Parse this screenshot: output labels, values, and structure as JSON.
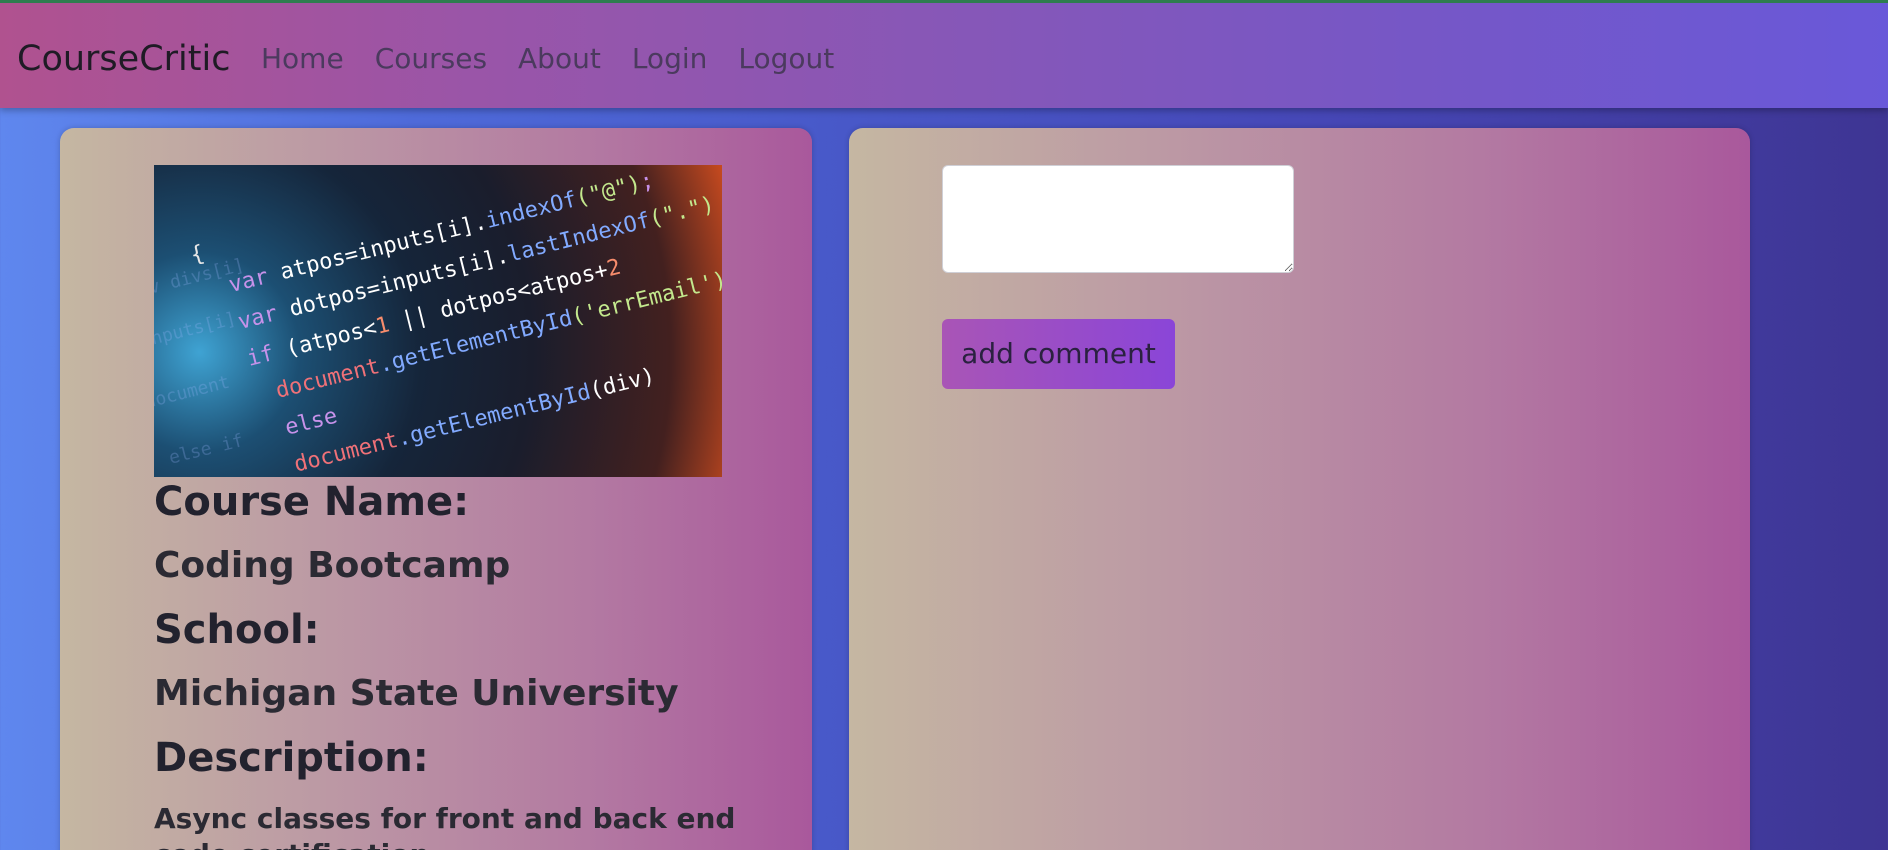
{
  "navbar": {
    "brand": "CourseCritic",
    "links": [
      "Home",
      "Courses",
      "About",
      "Login",
      "Logout"
    ]
  },
  "course": {
    "image_icon": "code-screenshot-image",
    "name_label": "Course Name:",
    "name_value": "Coding Bootcamp",
    "school_label": "School:",
    "school_value": "Michigan State University",
    "description_label": "Description:",
    "description_value": "Async classes for front and back end code certification"
  },
  "comment": {
    "placeholder": "",
    "button_label": "add comment"
  },
  "colors": {
    "navbar_start": "#b0528f",
    "navbar_end": "#6958d9",
    "button_start": "#a955b6",
    "button_end": "#8a45d8",
    "card_start": "#c5b7a2",
    "card_end": "#a9589c"
  }
}
